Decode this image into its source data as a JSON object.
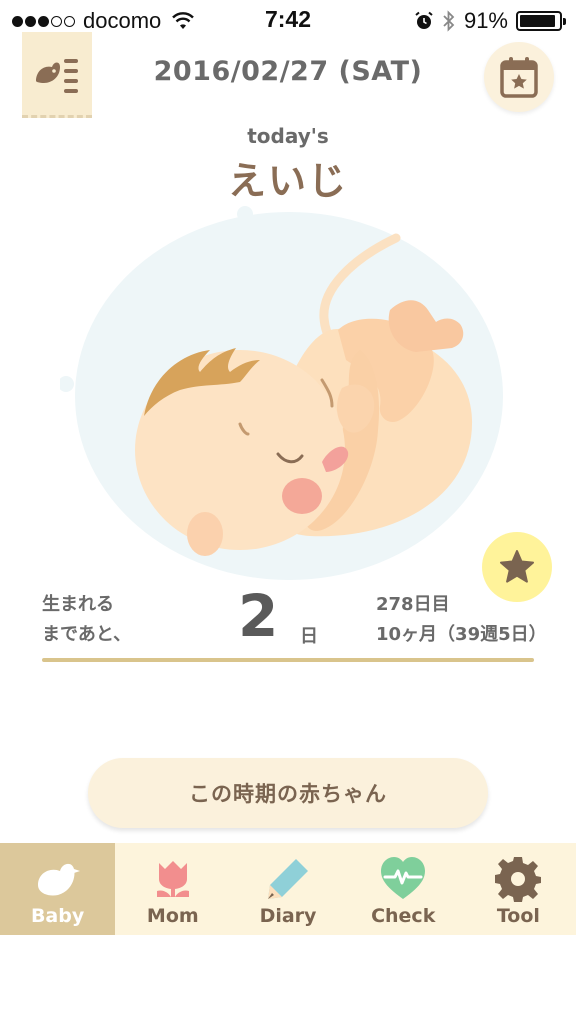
{
  "status": {
    "carrier": "docomo",
    "time": "7:42",
    "battery": "91%",
    "battery_level": 0.91
  },
  "header": {
    "date": "2016/02/27 (SAT)"
  },
  "today": {
    "label": "today's",
    "name": "えいじ"
  },
  "countdown": {
    "left_line1": "生まれる",
    "left_line2": "まであと、",
    "number": "2",
    "unit": "日",
    "right_line1": "278日目",
    "right_line2": "10ヶ月（39週5日）"
  },
  "info_button": {
    "label": "この時期の赤ちゃん"
  },
  "tabs": [
    {
      "label": "Baby",
      "icon": "bird-icon",
      "active": true
    },
    {
      "label": "Mom",
      "icon": "tulip-icon",
      "active": false
    },
    {
      "label": "Diary",
      "icon": "pencil-icon",
      "active": false
    },
    {
      "label": "Check",
      "icon": "heart-pulse-icon",
      "active": false
    },
    {
      "label": "Tool",
      "icon": "gear-icon",
      "active": false
    }
  ],
  "colors": {
    "accent": "#dcc89b",
    "tab_bg": "#fdf4dc",
    "star_button": "#fff39a",
    "name": "#8a6d55"
  }
}
